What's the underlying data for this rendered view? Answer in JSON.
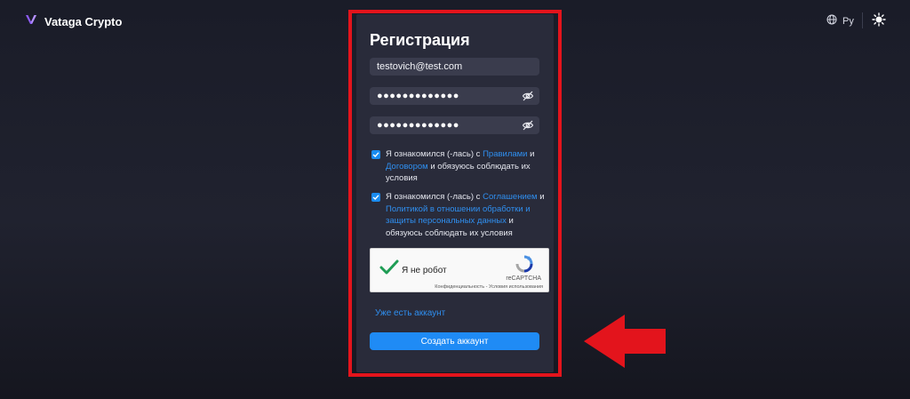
{
  "header": {
    "brand": "Vataga Crypto",
    "language": "Ру"
  },
  "form": {
    "title": "Регистрация",
    "email_value": "testovich@test.com",
    "password_mask": "●●●●●●●●●●●●●",
    "confirm_mask": "●●●●●●●●●●●●●",
    "agreement1": {
      "checked": true,
      "text_before": "Я ознакомился (-лась) с ",
      "link1": "Правилами",
      "text_mid": " и ",
      "link2": "Договором",
      "text_after": " и обязуюсь соблюдать их условия"
    },
    "agreement2": {
      "checked": true,
      "text_before": "Я ознакомился (-лась) с ",
      "link1": "Соглашением",
      "text_mid": " и ",
      "link2": "Политикой в отношении обработки и защиты персональных данных",
      "text_after": " и обязуюсь соблюдать их условия"
    },
    "captcha": {
      "label": "Я не робот",
      "brand": "reCAPTCHA",
      "links": "Конфиденциальность - Условия использования",
      "checked": true
    },
    "have_account": "Уже есть аккаунт",
    "submit_label": "Создать аккаунт"
  },
  "colors": {
    "accent": "#1f8bf5",
    "link": "#2f8ff0",
    "highlight_frame": "#e3141c",
    "card_bg": "#292b3a"
  },
  "icons": [
    "vataga-logo-icon",
    "globe-icon",
    "sun-icon",
    "eye-off-icon",
    "checkmark-icon",
    "recaptcha-logo-icon",
    "arrow-left-icon"
  ]
}
